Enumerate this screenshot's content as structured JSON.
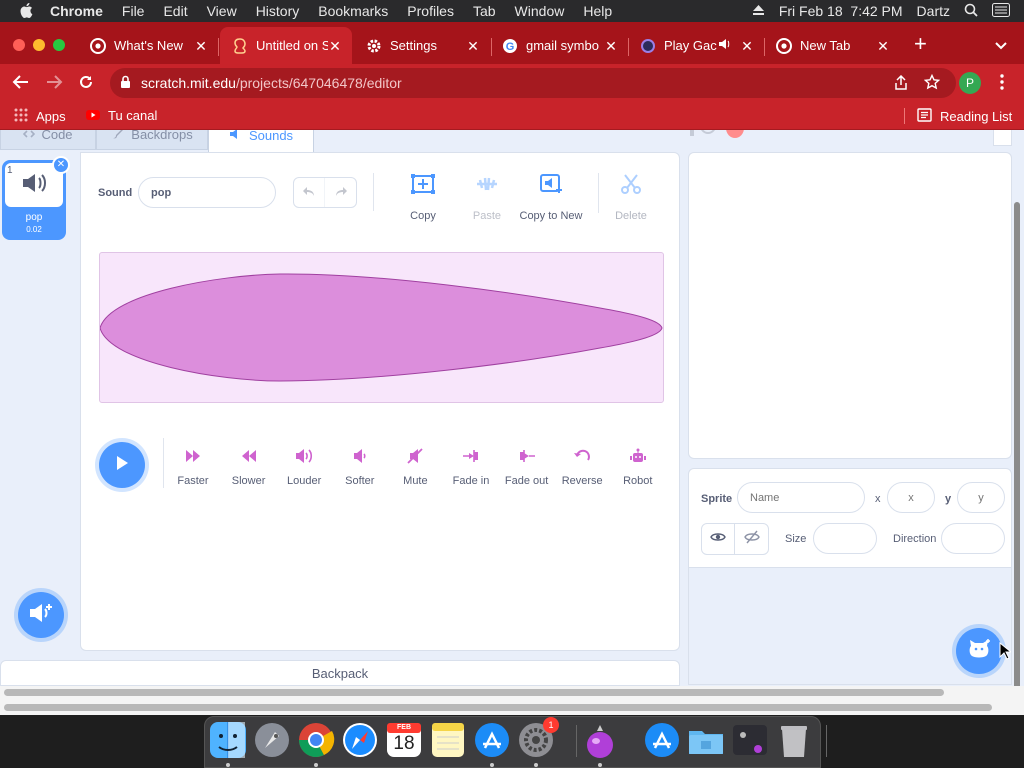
{
  "menubar": {
    "app": "Chrome",
    "items": [
      "File",
      "Edit",
      "View",
      "History",
      "Bookmarks",
      "Profiles",
      "Tab",
      "Window",
      "Help"
    ],
    "datetime": "Fri Feb 18  7:42 PM",
    "user": "Dartz"
  },
  "tabs": [
    {
      "title": "What's New",
      "icon": "chrome-icon"
    },
    {
      "title": "Untitled on S",
      "icon": "scratch-icon"
    },
    {
      "title": "Settings",
      "icon": "gear-icon"
    },
    {
      "title": "gmail symbo",
      "icon": "google-icon"
    },
    {
      "title": "Play Gac",
      "icon": "game-icon"
    },
    {
      "title": "New Tab",
      "icon": "chrome-icon"
    }
  ],
  "url": {
    "domain": "scratch.mit.edu",
    "path": "/projects/647046478/editor"
  },
  "profile_initial": "P",
  "bookmarks": {
    "apps": "Apps",
    "tu_canal": "Tu canal",
    "reading_list": "Reading List"
  },
  "editor": {
    "tabs": {
      "code": "Code",
      "backdrops": "Backdrops",
      "sounds": "Sounds"
    },
    "sound_item": {
      "index": "1",
      "name": "pop",
      "duration": "0.02"
    },
    "sound_label": "Sound",
    "sound_name_value": "pop",
    "tools": {
      "copy": "Copy",
      "paste": "Paste",
      "copy_to_new": "Copy to New",
      "delete": "Delete"
    },
    "effects": [
      "Faster",
      "Slower",
      "Louder",
      "Softer",
      "Mute",
      "Fade in",
      "Fade out",
      "Reverse",
      "Robot"
    ],
    "backpack": "Backpack"
  },
  "sprite_info": {
    "sprite_label": "Sprite",
    "name_placeholder": "Name",
    "x_label": "x",
    "x_placeholder": "x",
    "y_label": "y",
    "y_placeholder": "y",
    "size_label": "Size",
    "direction_label": "Direction"
  },
  "dock": {
    "apps": [
      "Finder",
      "Launchpad",
      "Chrome",
      "Safari",
      "Calendar",
      "Notes",
      "App Store",
      "System Preferences",
      "Scratch",
      "App Store 2",
      "Folder",
      "Utility",
      "Trash"
    ],
    "calendar_month": "FEB",
    "calendar_day": "18",
    "prefs_badge": "1"
  },
  "colors": {
    "chrome_red": "#c8232a",
    "scratch_blue": "#4c97ff",
    "sound_purple": "#cf63cf"
  }
}
